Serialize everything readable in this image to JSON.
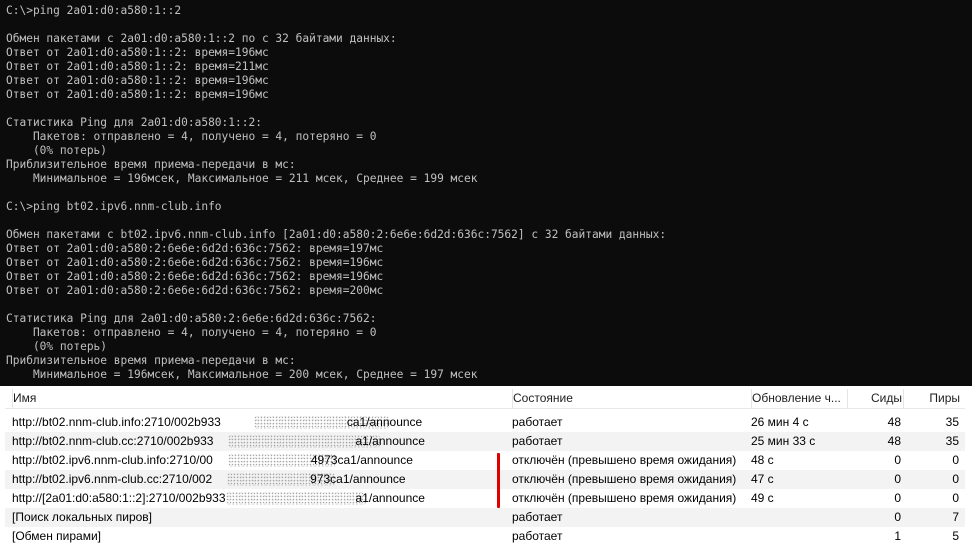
{
  "console": {
    "lines": [
      "C:\\>ping 2a01:d0:a580:1::2",
      "",
      "Обмен пакетами с 2a01:d0:a580:1::2 по с 32 байтами данных:",
      "Ответ от 2a01:d0:a580:1::2: время=196мс",
      "Ответ от 2a01:d0:a580:1::2: время=211мс",
      "Ответ от 2a01:d0:a580:1::2: время=196мс",
      "Ответ от 2a01:d0:a580:1::2: время=196мс",
      "",
      "Статистика Ping для 2a01:d0:a580:1::2:",
      "    Пакетов: отправлено = 4, получено = 4, потеряно = 0",
      "    (0% потерь)",
      "Приблизительное время приема-передачи в мс:",
      "    Минимальное = 196мсек, Максимальное = 211 мсек, Среднее = 199 мсек",
      "",
      "C:\\>ping bt02.ipv6.nnm-club.info",
      "",
      "Обмен пакетами с bt02.ipv6.nnm-club.info [2a01:d0:a580:2:6e6e:6d2d:636c:7562] с 32 байтами данных:",
      "Ответ от 2a01:d0:a580:2:6e6e:6d2d:636c:7562: время=197мс",
      "Ответ от 2a01:d0:a580:2:6e6e:6d2d:636c:7562: время=196мс",
      "Ответ от 2a01:d0:a580:2:6e6e:6d2d:636c:7562: время=196мс",
      "Ответ от 2a01:d0:a580:2:6e6e:6d2d:636c:7562: время=200мс",
      "",
      "Статистика Ping для 2a01:d0:a580:2:6e6e:6d2d:636c:7562:",
      "    Пакетов: отправлено = 4, получено = 4, потеряно = 0",
      "    (0% потерь)",
      "Приблизительное время приема-передачи в мс:",
      "    Минимальное = 196мсек, Максимальное = 200 мсек, Среднее = 197 мсек"
    ]
  },
  "trackers": {
    "columns": {
      "name": "Имя",
      "status": "Состояние",
      "update": "Обновление ч...",
      "seeds": "Сиды",
      "peers": "Пиры"
    },
    "rows": [
      {
        "name_prefix": "http://bt02.nnm-club.info:2710/002b933",
        "name_suffix": "ca1/announce",
        "status": "работает",
        "update": "26 мин 4 с",
        "seeds": "48",
        "peers": "35"
      },
      {
        "name_prefix": "http://bt02.nnm-club.cc:2710/002b933",
        "name_suffix": "a1/announce",
        "status": "работает",
        "update": "25 мин 33 с",
        "seeds": "48",
        "peers": "35"
      },
      {
        "name_prefix": "http://bt02.ipv6.nnm-club.info:2710/00",
        "name_suffix": "4973ca1/announce",
        "status": "отключён (превышено время ожидания)",
        "update": "48 с",
        "seeds": "0",
        "peers": "0"
      },
      {
        "name_prefix": "http://bt02.ipv6.nnm-club.cc:2710/002",
        "name_suffix": "973ca1/announce",
        "status": "отключён (превышено время ожидания)",
        "update": "47 с",
        "seeds": "0",
        "peers": "0"
      },
      {
        "name_prefix": "http://[2a01:d0:a580:1::2]:2710/002b933",
        "name_suffix": "a1/announce",
        "status": "отключён (превышено время ожидания)",
        "update": "49 с",
        "seeds": "0",
        "peers": "0"
      },
      {
        "name_prefix": "[Поиск локальных пиров]",
        "name_suffix": "",
        "status": "работает",
        "update": "",
        "seeds": "0",
        "peers": "7"
      },
      {
        "name_prefix": "[Обмен пирами]",
        "name_suffix": "",
        "status": "работает",
        "update": "",
        "seeds": "1",
        "peers": "5"
      }
    ]
  },
  "colors": {
    "console_bg": "#0c0c0c",
    "console_text": "#c0c0c0",
    "annotation": "#e00000"
  }
}
